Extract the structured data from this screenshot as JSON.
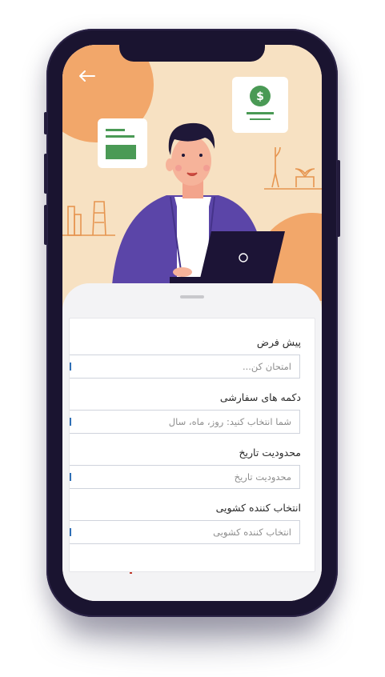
{
  "app": {
    "back_label": "back"
  },
  "hero": {
    "colors": {
      "background": "#f7e1c2",
      "accent_orange": "#f2a76a",
      "shirt_purple": "#5b45a8",
      "laptop": "#1c1436",
      "green": "#4a9a55"
    },
    "money_card_icon": "dollar-icon",
    "document_card_icon": "document-icon"
  },
  "form": {
    "fields": [
      {
        "label": "پیش فرض",
        "placeholder": "امتحان کن..."
      },
      {
        "label": "دکمه های سفارشی",
        "placeholder": "شما انتخاب کنید: روز، ماه، سال"
      },
      {
        "label": "محدودیت تاریخ",
        "placeholder": "محدودیت تاریخ"
      },
      {
        "label": "انتخاب کننده کشویی",
        "placeholder": "انتخاب کننده کشویی"
      }
    ]
  }
}
